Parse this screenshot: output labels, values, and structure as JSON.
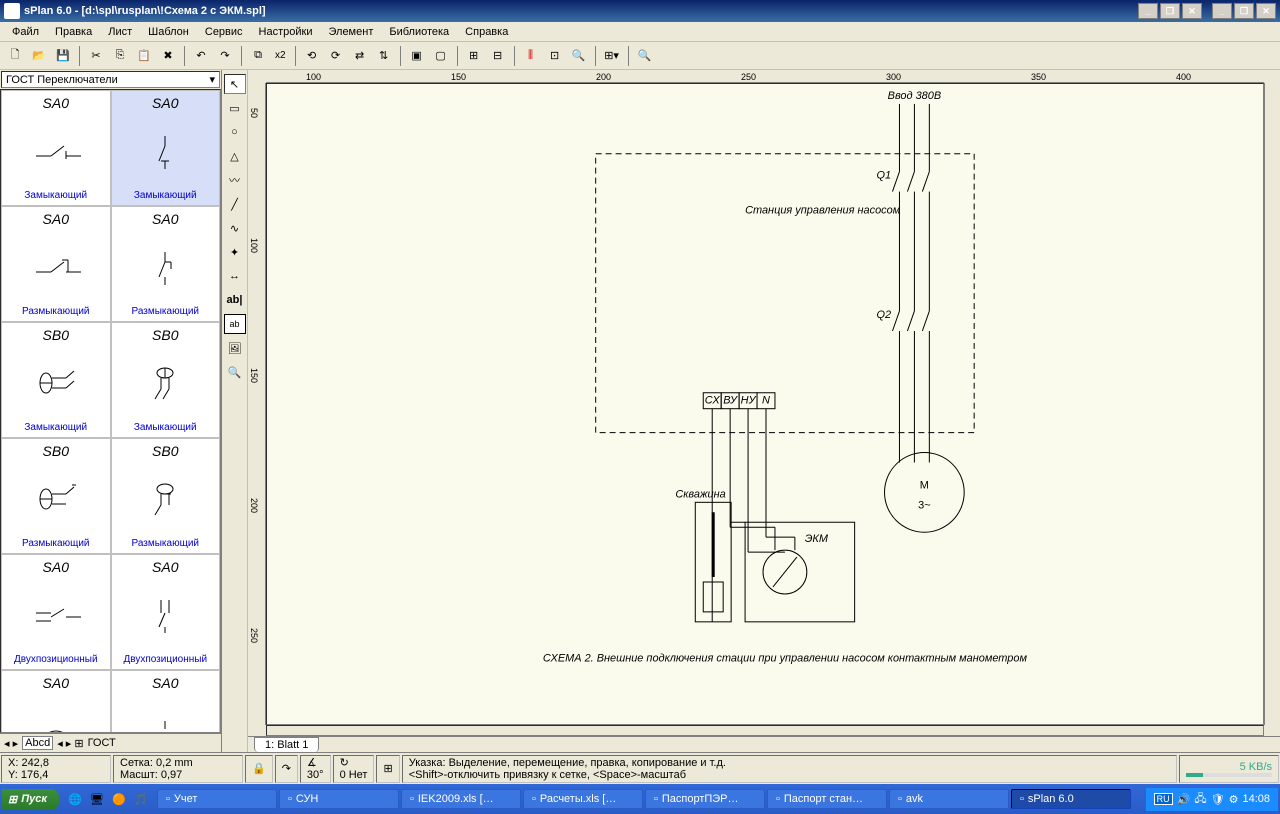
{
  "title": "sPlan 6.0 - [d:\\spl\\rusplan\\!Схема 2 с ЭКМ.spl]",
  "menu": [
    "Файл",
    "Правка",
    "Лист",
    "Шаблон",
    "Сервис",
    "Настройки",
    "Элемент",
    "Библиотека",
    "Справка"
  ],
  "library_selector": "ГОСТ Переключатели",
  "lib_items": [
    {
      "code": "SA0",
      "label": "Замыкающий"
    },
    {
      "code": "SA0",
      "label": "Замыкающий",
      "sel": true
    },
    {
      "code": "SA0",
      "label": "Размыкающий"
    },
    {
      "code": "SA0",
      "label": "Размыкающий"
    },
    {
      "code": "SB0",
      "label": "Замыкающий"
    },
    {
      "code": "SB0",
      "label": "Замыкающий"
    },
    {
      "code": "SB0",
      "label": "Размыкающий"
    },
    {
      "code": "SB0",
      "label": "Размыкающий"
    },
    {
      "code": "SA0",
      "label": "Двухпозиционный"
    },
    {
      "code": "SA0",
      "label": "Двухпозиционный"
    },
    {
      "code": "SA0",
      "label": ""
    },
    {
      "code": "SA0",
      "label": ""
    }
  ],
  "sidebar_footer": "ГОСТ",
  "hruler_ticks": [
    "100",
    "150",
    "200",
    "250",
    "300",
    "350",
    "400"
  ],
  "vruler_ticks": [
    "50",
    "100",
    "150",
    "200",
    "250"
  ],
  "sheet_tab": "1: Blatt 1",
  "schematic": {
    "vvod": "Ввод 380В",
    "station": "Станция управления насосом",
    "motor_top": "M",
    "motor_bot": "3~",
    "q1": "Q1",
    "q2": "Q2",
    "well": "Скважина",
    "ekm": "ЭКМ",
    "terms": [
      "СХ",
      "ВУ",
      "НУ",
      "N"
    ],
    "caption": "СХЕМА 2. Внешние подключения стации при управлении насосом контактным манометром"
  },
  "status": {
    "x": "X: 242,8",
    "y": "Y: 176,4",
    "grid": "Сетка: 0,2 mm",
    "scale": "Масшт: 0,97",
    "angle": "30°",
    "snap": "0 Нет",
    "hint1": "Указка: Выделение, перемещение, правка, копирование и т.д.",
    "hint2": "<Shift>-отключить привязку к сетке, <Space>-масштаб",
    "x2": "x2"
  },
  "taskbar": {
    "start": "Пуск",
    "tasks": [
      "Учет",
      "СУН",
      "IEK2009.xls […",
      "Расчеты.xls […",
      "ПаспортПЭР…",
      "Паспорт стан…",
      "avk",
      "sPlan 6.0"
    ],
    "speed": "5 KB/s",
    "lang": "RU",
    "clock": "14:08"
  }
}
